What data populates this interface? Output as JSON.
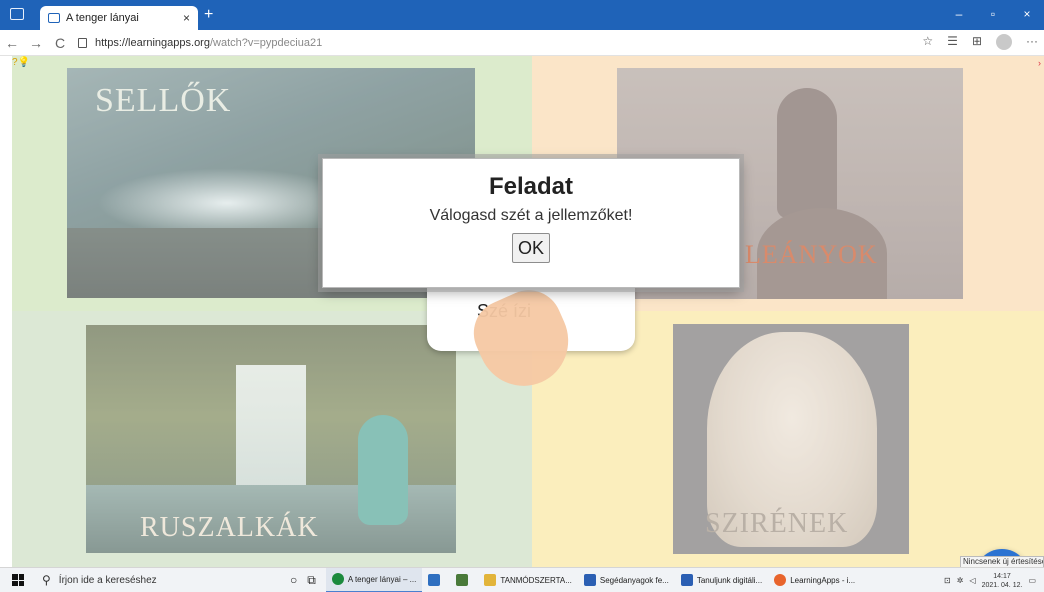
{
  "browser": {
    "tab_title": "A tenger lányai",
    "tab_close": "×",
    "new_tab": "+",
    "url_host": "https://learningapps.org",
    "url_path": "/watch?v=pypdeciua21",
    "window_minimize": "–",
    "window_maximize": "▫",
    "window_close": "×",
    "back": "←",
    "forward": "→",
    "refresh": "C"
  },
  "quadrants": {
    "top_left": {
      "label": "SELLŐK"
    },
    "top_right": {
      "label": "LEÁNYOK"
    },
    "bottom_left": {
      "label": "RUSZALKÁK"
    },
    "bottom_right": {
      "label": "SZIRÉNEK"
    }
  },
  "card": {
    "text": "Szé     ízi"
  },
  "modal": {
    "title": "Feladat",
    "text": "Válogasd szét a jellemzőket!",
    "ok_label": "OK"
  },
  "notification": {
    "text": "Nincsenek új értesítések"
  },
  "taskbar": {
    "search_placeholder": "Írjon ide a kereséshez",
    "apps": [
      {
        "label": "A tenger lányai – ...",
        "color": "#1c8a3d"
      },
      {
        "label": "",
        "color": "#2f6fc0"
      },
      {
        "label": "",
        "color": "#4a7a3a"
      },
      {
        "label": "TANMÓDSZERTA...",
        "color": "#e2b43a"
      },
      {
        "label": "Segédanyagok fe...",
        "color": "#2b5fb3"
      },
      {
        "label": "Tanuljunk digitáli...",
        "color": "#2b5fb3"
      },
      {
        "label": "LearningApps - i...",
        "color": "#e8642c"
      }
    ],
    "time": "14:17",
    "date": "2021. 04. 12."
  },
  "colors": {
    "accent": "#1f63b8",
    "fab": "#2c73d2"
  }
}
